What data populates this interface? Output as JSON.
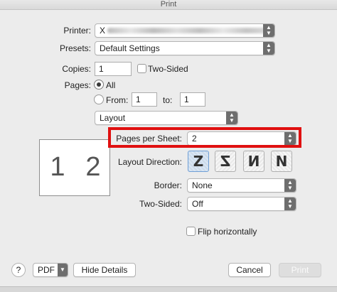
{
  "window": {
    "title": "Print"
  },
  "printer": {
    "label": "Printer:",
    "value_prefix": "X"
  },
  "presets": {
    "label": "Presets:",
    "value": "Default Settings"
  },
  "copies": {
    "label": "Copies:",
    "value": "1",
    "two_sided_label": "Two-Sided"
  },
  "pages": {
    "label": "Pages:",
    "all_label": "All",
    "from_label": "From:",
    "from_value": "1",
    "to_label": "to:",
    "to_value": "1"
  },
  "section": {
    "value": "Layout"
  },
  "layout": {
    "pages_per_sheet_label": "Pages per Sheet:",
    "pages_per_sheet_value": "2",
    "layout_direction_label": "Layout Direction:",
    "directions": [
      "Z",
      "Z",
      "N",
      "N"
    ],
    "border_label": "Border:",
    "border_value": "None",
    "two_sided_label": "Two-Sided:",
    "two_sided_value": "Off",
    "flip_label": "Flip horizontally"
  },
  "preview": {
    "pages": [
      "1",
      "2"
    ]
  },
  "footer": {
    "help": "?",
    "pdf": "PDF",
    "hide_details": "Hide Details",
    "cancel": "Cancel",
    "print": "Print"
  },
  "colors": {
    "highlight": "#e01010",
    "selected_direction": "#d8e6f5"
  }
}
